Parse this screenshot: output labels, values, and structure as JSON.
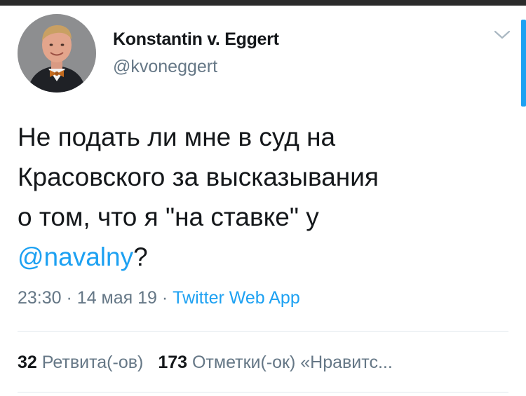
{
  "tweet": {
    "author": {
      "display_name": "Konstantin v. Eggert",
      "handle": "@kvoneggert"
    },
    "text_lines": [
      "Не подать ли мне в суд на",
      "Красовского за высказывания",
      "о том, что я \"на ставке\" у"
    ],
    "mention": "@navalny",
    "mention_suffix": "?",
    "time": "23:30",
    "date": "14 мая 19",
    "separator": "·",
    "source": "Twitter Web App",
    "retweets": {
      "count": "32",
      "label": "Ретвита(-ов)"
    },
    "likes": {
      "count": "173",
      "label": "Отметки(-ок) «Нравитс..."
    }
  },
  "colors": {
    "link": "#1da1f2",
    "secondary_text": "#657786",
    "primary_text": "#14171a"
  },
  "icons": {
    "more": "chevron-down-icon"
  }
}
